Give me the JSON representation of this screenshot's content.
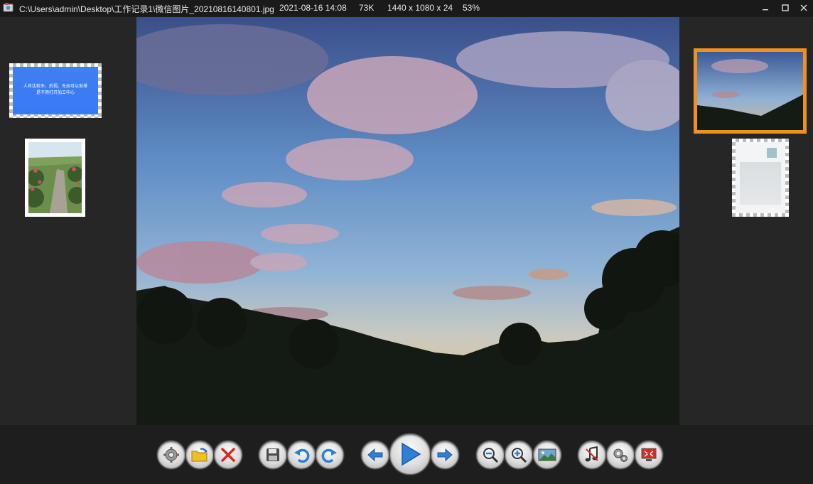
{
  "titlebar": {
    "path": "C:\\Users\\admin\\Desktop\\工作记录1\\微信图片_20210816140801.jpg",
    "datetime": "2021-08-16 14:08",
    "filesize": "73K",
    "dimensions": "1440 x 1080 x 24",
    "zoom": "53%",
    "buttons": [
      "minimize",
      "maximize",
      "close"
    ]
  },
  "thumbnails": {
    "left": [
      {
        "name": "blue-text-image",
        "text_line1": "人肖比较多、后视、先出可以安排",
        "text_line2": "是不用打开加工中心"
      },
      {
        "name": "garden-path-image"
      }
    ],
    "right": [
      {
        "name": "sunset-sky-image",
        "selected": true
      },
      {
        "name": "document-image",
        "selected": false
      }
    ]
  },
  "toolbar": {
    "groups": [
      [
        "settings-icon",
        "open-folder-icon",
        "delete-icon"
      ],
      [
        "save-icon",
        "rotate-left-icon",
        "rotate-right-icon"
      ],
      [
        "previous-icon",
        "play-icon",
        "next-icon"
      ],
      [
        "zoom-out-icon",
        "zoom-in-icon",
        "fit-image-icon"
      ],
      [
        "music-icon",
        "options-icon",
        "fullscreen-icon"
      ]
    ]
  },
  "colors": {
    "accent": "#f0901e",
    "background": "#1c1c1c",
    "pane": "#262626",
    "arrow_blue": "#2e7fd6"
  }
}
